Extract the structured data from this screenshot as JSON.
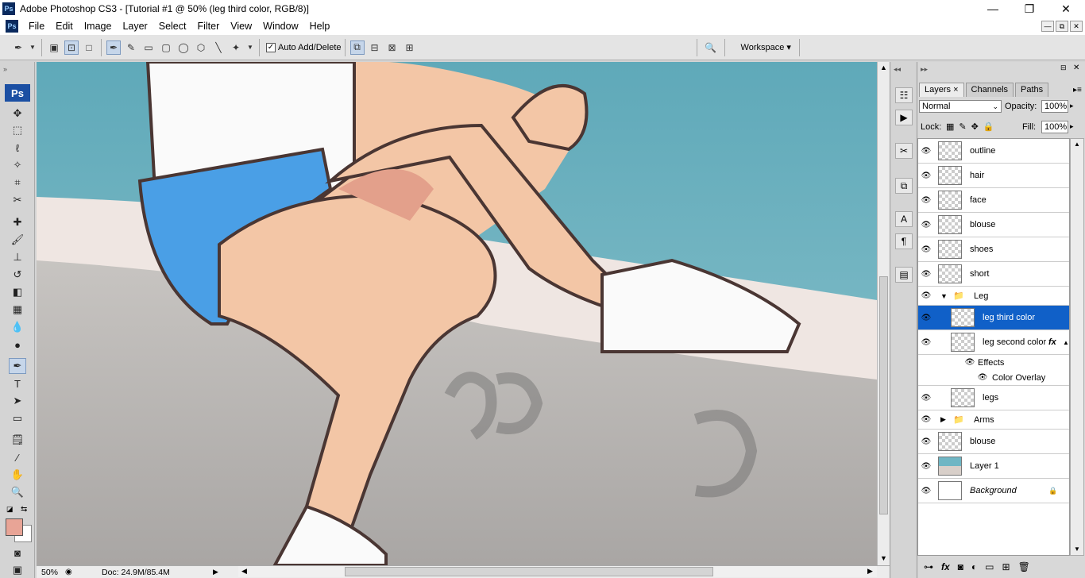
{
  "window": {
    "title": "Adobe Photoshop CS3 - [Tutorial #1 @ 50% (leg third color, RGB/8)]",
    "app_icon": "Ps",
    "minimize": "—",
    "restore": "❐",
    "close": "✕"
  },
  "menu": [
    "File",
    "Edit",
    "Image",
    "Layer",
    "Select",
    "Filter",
    "View",
    "Window",
    "Help"
  ],
  "mdi_controls": {
    "min": "—",
    "restore": "⧉",
    "close": "✕"
  },
  "options": {
    "auto_add_delete": "Auto Add/Delete",
    "auto_checked": "✓",
    "workspace": "Workspace",
    "workspace_arrow": "▾"
  },
  "toolbox": {
    "logo": "Ps"
  },
  "status": {
    "zoom": "50%",
    "doc": "Doc: 24.9M/85.4M",
    "arrow": "▶"
  },
  "layers_panel": {
    "tabs": [
      "Layers",
      "Channels",
      "Paths"
    ],
    "tab_close": "×",
    "blend_mode": "Normal",
    "opacity_label": "Opacity:",
    "opacity": "100%",
    "lock_label": "Lock:",
    "fill_label": "Fill:",
    "fill": "100%",
    "layers": [
      {
        "name": "outline",
        "type": "layer"
      },
      {
        "name": "hair",
        "type": "layer"
      },
      {
        "name": "face",
        "type": "layer"
      },
      {
        "name": "blouse",
        "type": "layer"
      },
      {
        "name": "shoes",
        "type": "layer"
      },
      {
        "name": "short",
        "type": "layer"
      },
      {
        "name": "Leg",
        "type": "group",
        "expanded": true
      },
      {
        "name": "leg third color",
        "type": "layer",
        "selected": true,
        "indent": true
      },
      {
        "name": "leg second color",
        "type": "layer",
        "indent": true,
        "fx": "fx"
      },
      {
        "name": "Effects",
        "type": "effects"
      },
      {
        "name": "Color Overlay",
        "type": "effect"
      },
      {
        "name": "legs",
        "type": "layer",
        "indent": true
      },
      {
        "name": "Arms",
        "type": "group",
        "expanded": false
      },
      {
        "name": "blouse",
        "type": "layer"
      },
      {
        "name": "Layer 1",
        "type": "photo"
      },
      {
        "name": "Background",
        "type": "background",
        "italic": true,
        "lock": "🔒"
      }
    ]
  },
  "colors": {
    "sky_sea": "#5fa9b9",
    "skin": "#f3c6a6",
    "skin_shadow": "#e3a08b",
    "shorts": "#4a9fe6",
    "outline": "#4a3633",
    "fg_swatch": "#e8a496",
    "selection": "#1060c8"
  },
  "icons": {
    "eye": "👁",
    "folder": "📁",
    "expanded": "▼",
    "collapsed": "▶",
    "scroll_up": "▲",
    "scroll_down": "▼",
    "scroll_left": "◀",
    "scroll_right": "▶"
  }
}
